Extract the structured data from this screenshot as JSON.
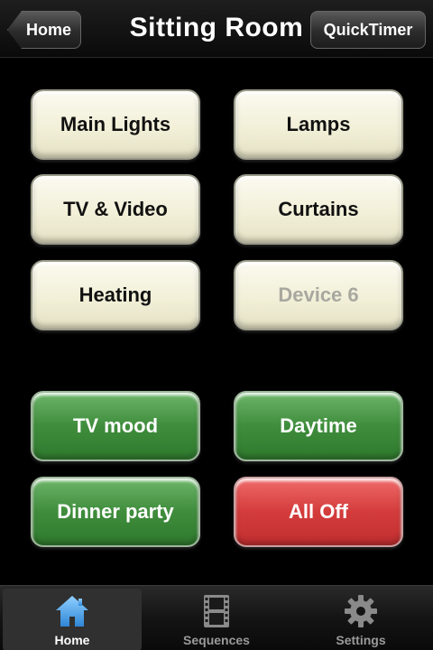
{
  "navbar": {
    "title": "Sitting Room",
    "back_label": "Home",
    "right_label": "QuickTimer"
  },
  "devices": [
    {
      "label": "Main Lights",
      "enabled": true
    },
    {
      "label": "Lamps",
      "enabled": true
    },
    {
      "label": "TV & Video",
      "enabled": true
    },
    {
      "label": "Curtains",
      "enabled": true
    },
    {
      "label": "Heating",
      "enabled": true
    },
    {
      "label": "Device 6",
      "enabled": false
    }
  ],
  "moods": [
    {
      "label": "TV mood",
      "color": "#3f8d3c"
    },
    {
      "label": "Daytime",
      "color": "#3f8d3c"
    },
    {
      "label": "Dinner party",
      "color": "#3f8d3c"
    },
    {
      "label": "All Off",
      "color": "#d43c3c"
    }
  ],
  "tabs": [
    {
      "label": "Home",
      "icon": "house-icon",
      "active": true
    },
    {
      "label": "Sequences",
      "icon": "film-strip-icon",
      "active": false
    },
    {
      "label": "Settings",
      "icon": "gear-icon",
      "active": false
    }
  ],
  "colors": {
    "active_tab_icon": "#4aa3e8",
    "inactive_tab_icon": "#8a8a8a"
  }
}
